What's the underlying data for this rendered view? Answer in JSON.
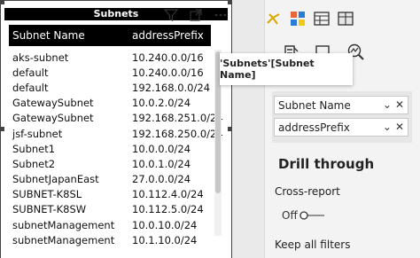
{
  "visual": {
    "title": "Subnets",
    "columns": [
      "Subnet Name",
      "addressPrefix"
    ],
    "rows": [
      [
        "aks-subnet",
        "10.240.0.0/16"
      ],
      [
        "default",
        "10.240.0.0/16"
      ],
      [
        "default",
        "192.168.0.0/24"
      ],
      [
        "GatewaySubnet",
        "10.0.2.0/24"
      ],
      [
        "GatewaySubnet",
        "192.168.251.0/24"
      ],
      [
        "jsf-subnet",
        "192.168.250.0/24"
      ],
      [
        "Subnet1",
        "10.0.0.0/24"
      ],
      [
        "Subnet2",
        "10.0.1.0/24"
      ],
      [
        "SubnetJapanEast",
        "27.0.0.0/24"
      ],
      [
        "SUBNET-K8SL",
        "10.112.4.0/24"
      ],
      [
        "SUBNET-K8SW",
        "10.112.5.0/24"
      ],
      [
        "subnetManagement",
        "10.0.10.0/24"
      ],
      [
        "subnetManagement",
        "10.1.10.0/24"
      ]
    ],
    "icons": [
      "filter-icon",
      "focus-mode-icon",
      "more-options-icon"
    ]
  },
  "tooltip": {
    "text": "'Subnets'[Subnet Name]"
  },
  "pane": {
    "fields": [
      {
        "label": "Subnet Name",
        "expand": "⌄",
        "remove": "✕"
      },
      {
        "label": "addressPrefix",
        "expand": "⌄",
        "remove": "✕"
      }
    ],
    "drill_through": "Drill through",
    "cross_report": "Cross-report",
    "toggle_state": "Off",
    "keep_all_filters": "Keep all filters",
    "accent": "#f2c811"
  }
}
